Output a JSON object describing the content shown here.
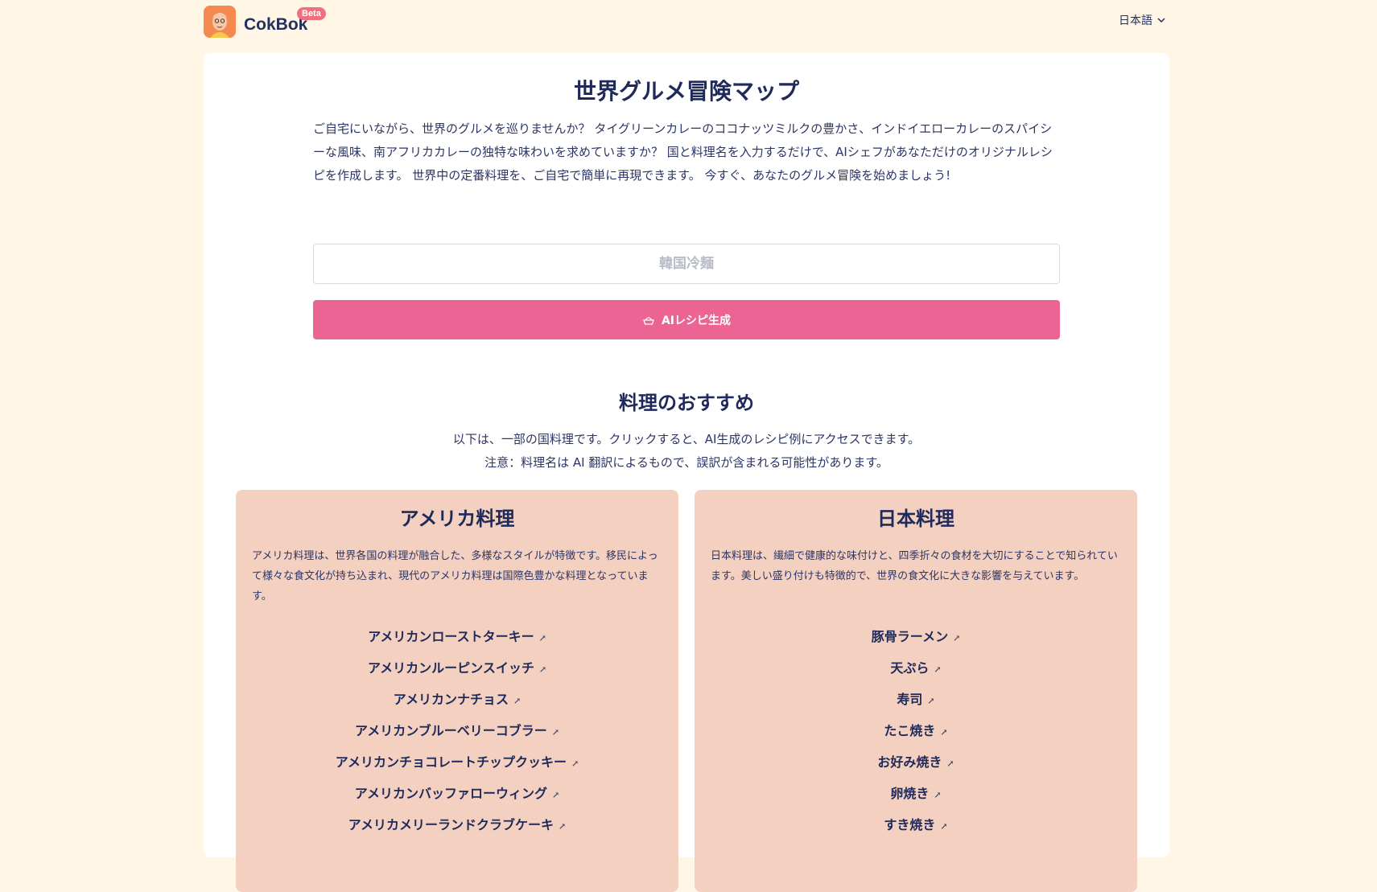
{
  "header": {
    "brand_name": "CokBok",
    "badge": "Beta",
    "language": "日本語"
  },
  "main": {
    "title": "世界グルメ冒険マップ",
    "intro": "ご自宅にいながら、世界のグルメを巡りませんか？ タイグリーンカレーのココナッツミルクの豊かさ、インドイエローカレーのスパイシーな風味、南アフリカカレーの独特な味わいを求めていますか？ 国と料理名を入力するだけで、AIシェフがあなただけのオリジナルレシピを作成します。 世界中の定番料理を、ご自宅で簡単に再現できます。 今すぐ、あなたのグルメ冒険を始めましょう!",
    "search_placeholder": "韓国冷麺",
    "generate_label": "AIレシピ生成"
  },
  "recommendations": {
    "title": "料理のおすすめ",
    "desc_line1": "以下は、一部の国料理です。クリックすると、AI生成のレシピ例にアクセスできます。",
    "desc_line2": "注意：料理名は AI 翻訳によるもので、誤訳が含まれる可能性があります。"
  },
  "cuisines": [
    {
      "title": "アメリカ料理",
      "description": "アメリカ料理は、世界各国の料理が融合した、多様なスタイルが特徴です。移民によって様々な食文化が持ち込まれ、現代のアメリカ料理は国際色豊かな料理となっています。",
      "dishes": [
        "アメリカンローストターキー",
        "アメリカンルーピンスイッチ",
        "アメリカンナチョス",
        "アメリカンブルーベリーコブラー",
        "アメリカンチョコレートチップクッキー",
        "アメリカンバッファローウィング",
        "アメリカメリーランドクラブケーキ"
      ]
    },
    {
      "title": "日本料理",
      "description": "日本料理は、繊細で健康的な味付けと、四季折々の食材を大切にすることで知られています。美しい盛り付けも特徴的で、世界の食文化に大きな影響を与えています。",
      "dishes": [
        "豚骨ラーメン",
        "天ぷら",
        "寿司",
        "たこ焼き",
        "お好み焼き",
        "卵焼き",
        "すき焼き"
      ]
    }
  ],
  "icons": {
    "logo": "chef-avatar-icon",
    "language": "chevron-down-icon",
    "generate": "cooking-pot-icon",
    "dish_link": "external-link-icon"
  },
  "colors": {
    "background": "#fff6e6",
    "primary_button": "#ec6494",
    "cuisine_card": "#f3d0c0",
    "badge": "#f06f7e",
    "text": "#1f2a5a"
  }
}
